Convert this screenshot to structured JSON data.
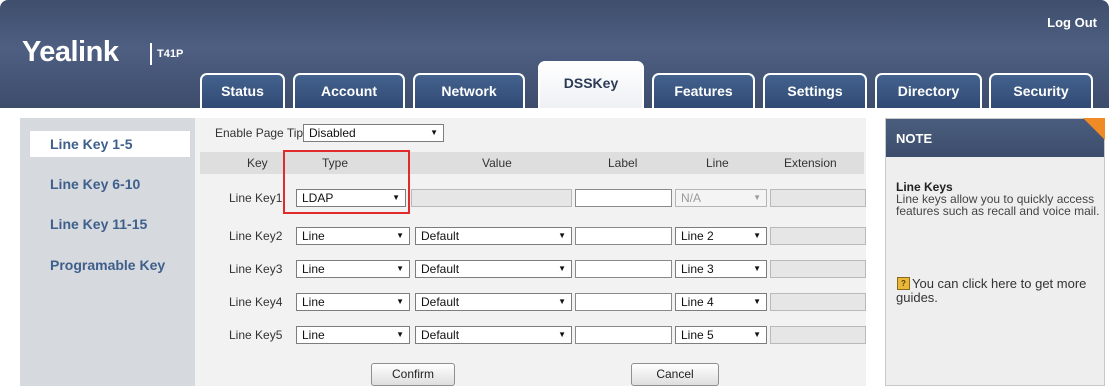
{
  "header": {
    "logo": "Yealink",
    "model": "T41P",
    "logout": "Log Out",
    "tabs": [
      "Status",
      "Account",
      "Network",
      "DSSKey",
      "Features",
      "Settings",
      "Directory",
      "Security"
    ],
    "active_tab": "DSSKey"
  },
  "sidebar": {
    "items": [
      "Line Key 1-5",
      "Line Key 6-10",
      "Line Key 11-15",
      "Programable Key"
    ],
    "active": "Line Key 1-5"
  },
  "main": {
    "page_tips_label": "Enable Page Tips",
    "page_tips_value": "Disabled",
    "columns": [
      "Key",
      "Type",
      "Value",
      "Label",
      "Line",
      "Extension"
    ],
    "rows": [
      {
        "key": "Line Key1",
        "type": "LDAP",
        "value": "",
        "label": "",
        "line": "N/A",
        "extension": ""
      },
      {
        "key": "Line Key2",
        "type": "Line",
        "value": "Default",
        "label": "",
        "line": "Line 2",
        "extension": ""
      },
      {
        "key": "Line Key3",
        "type": "Line",
        "value": "Default",
        "label": "",
        "line": "Line 3",
        "extension": ""
      },
      {
        "key": "Line Key4",
        "type": "Line",
        "value": "Default",
        "label": "",
        "line": "Line 4",
        "extension": ""
      },
      {
        "key": "Line Key5",
        "type": "Line",
        "value": "Default",
        "label": "",
        "line": "Line 5",
        "extension": ""
      }
    ],
    "confirm": "Confirm",
    "cancel": "Cancel"
  },
  "note": {
    "title": "NOTE",
    "subtitle": "Line Keys",
    "text": "Line keys allow you to quickly access features such as recall and voice mail.",
    "guide": "You can click here to get more guides."
  },
  "colors": {
    "header": "#3f4e6c",
    "tab": "#2f4a74",
    "sidebar_text": "#3e5f8c",
    "highlight": "#e12a2a",
    "note_accent": "#f08a24"
  },
  "icons": {
    "dropdown": "chevron-down-icon",
    "guide": "help-book-icon"
  }
}
